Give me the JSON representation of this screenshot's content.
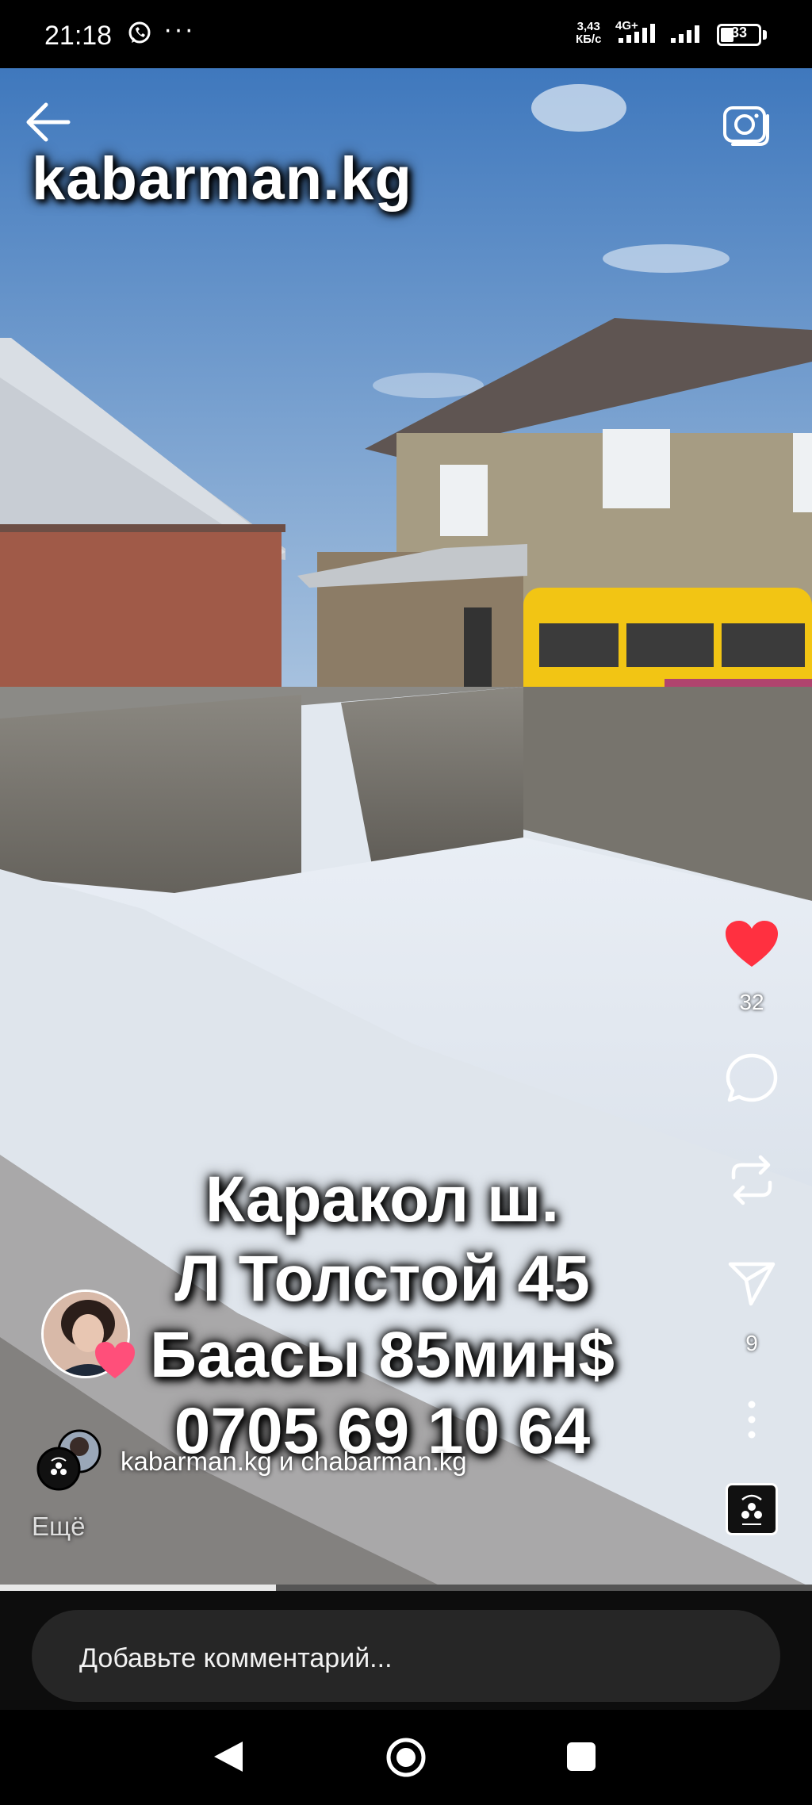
{
  "status_bar": {
    "time": "21:18",
    "speed_value": "3,43",
    "speed_unit": "КБ/с",
    "network": "4G+",
    "battery": "33",
    "icons": [
      "whatsapp-icon",
      "more-dots-icon",
      "signal-icon",
      "battery-icon"
    ]
  },
  "reel": {
    "watermark": "kabarman.kg",
    "caption_lines": [
      "Каракол ш.",
      "Л Толстой 45",
      "Баасы 85мин$",
      "0705 69 10 64"
    ],
    "likes": "32",
    "shares": "9",
    "authors": "kabarman.kg и chabarman.kg",
    "more": "Ещё",
    "progress": 0.34
  },
  "comment": {
    "placeholder": "Добавьте комментарий..."
  },
  "colors": {
    "like_red": "#ff3040",
    "sky": "#4f86c6",
    "bus_yellow": "#f2c514"
  }
}
